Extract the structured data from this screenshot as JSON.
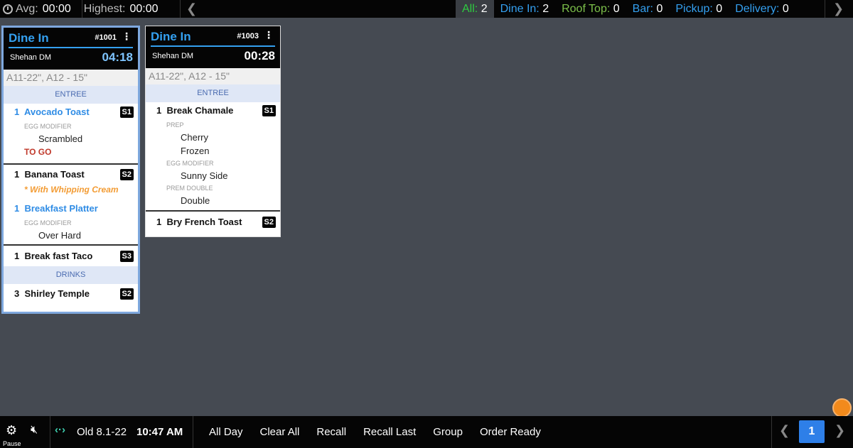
{
  "topbar": {
    "avg_label": "Avg:",
    "avg_value": "00:00",
    "highest_label": "Highest:",
    "highest_value": "00:00",
    "filters": [
      {
        "label": "All:",
        "count": "2",
        "color": "#2ecc40"
      },
      {
        "label": "Dine In:",
        "count": "2",
        "color": "#34a0f0"
      },
      {
        "label": "Roof Top:",
        "count": "0",
        "color": "#7cc04a"
      },
      {
        "label": "Bar:",
        "count": "0",
        "color": "#34a0f0"
      },
      {
        "label": "Pickup:",
        "count": "0",
        "color": "#34a0f0"
      },
      {
        "label": "Delivery:",
        "count": "0",
        "color": "#34a0f0"
      }
    ]
  },
  "tickets": [
    {
      "type": "Dine In",
      "number": "#1001",
      "server": "Shehan DM",
      "timer": "04:18",
      "tables": "A11-22\", A12 - 15\"",
      "courses": {
        "entree": "ENTREE",
        "drinks": "DRINKS"
      },
      "items": {
        "avocado": {
          "qty": "1",
          "name": "Avocado Toast",
          "seat": "S1",
          "mod_header": "EGG MODIFIER",
          "mod_value": "Scrambled",
          "flag": "TO GO"
        },
        "banana": {
          "qty": "1",
          "name": "Banana Toast",
          "seat": "S2",
          "note": "* With Whipping Cream"
        },
        "platter": {
          "qty": "1",
          "name": "Breakfast Platter",
          "mod_header": "EGG MODIFIER",
          "mod_value": "Over Hard"
        },
        "taco": {
          "qty": "1",
          "name": "Break fast Taco",
          "seat": "S3"
        },
        "shirley": {
          "qty": "3",
          "name": "Shirley Temple",
          "seat": "S2"
        }
      }
    },
    {
      "type": "Dine In",
      "number": "#1003",
      "server": "Shehan DM",
      "timer": "00:28",
      "tables": "A11-22\", A12 - 15\"",
      "courses": {
        "entree": "ENTREE"
      },
      "items": {
        "chamale": {
          "qty": "1",
          "name": "Break Chamale",
          "seat": "S1",
          "prep_header": "PREP",
          "prep_1": "Cherry",
          "prep_2": "Frozen",
          "egg_header": "EGG MODIFIER",
          "egg_value": "Sunny Side",
          "prem_header": "PREM DOUBLE",
          "prem_value": "Double"
        },
        "french": {
          "qty": "1",
          "name": "Bry French Toast",
          "seat": "S2"
        }
      }
    }
  ],
  "bottombar": {
    "pause_label": "Pause",
    "version": "Old 8.1-22",
    "time": "10:47 AM",
    "actions": [
      "All Day",
      "Clear All",
      "Recall",
      "Recall Last",
      "Group",
      "Order Ready"
    ],
    "page": "1"
  },
  "icons": {
    "settings": "gear-icon",
    "mute": "speaker-muted-icon",
    "connection": "connection-icon",
    "clock": "clock-icon"
  }
}
